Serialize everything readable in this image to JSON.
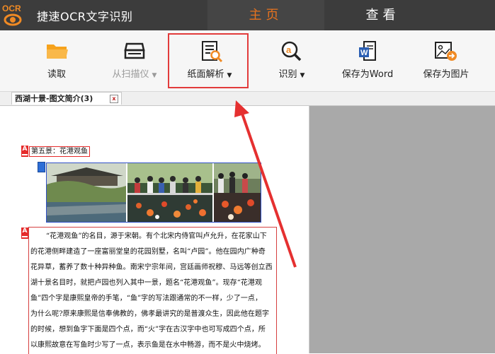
{
  "app": {
    "logo_text": "OCR",
    "title": "捷速OCR文字识别"
  },
  "tabs": [
    {
      "label": "主页",
      "active": true
    },
    {
      "label": "查看",
      "active": false
    }
  ],
  "toolbar": {
    "read": "读取",
    "scanner": "从扫描仪",
    "parse": "纸面解析",
    "recognize": "识别",
    "save_word": "保存为Word",
    "save_image": "保存为图片"
  },
  "colors": {
    "accent": "#e8731e",
    "highlight": "#e23b3b",
    "titlebar": "#3c3c3c"
  },
  "document": {
    "tab_title": "西湖十景-图文简介(3)",
    "tab_close": "x",
    "heading_marker": "A",
    "heading": "第五景：花港观鱼",
    "text_marker": "A",
    "lines": [
      "“花港观鱼”的名目，源于宋朝。有个北宋内侍官叫卢允升，在花家山下",
      "的花港侧畔建造了一座富丽堂皇的花园别墅，名叫“卢园”。他在园内广种奇",
      "花异草，蓄养了数十种异种鱼。南宋宁宗年间，宫廷画师祝穆、马远等创立西",
      "湖十景名目时，就把卢园也列入其中一景，题名“花港观鱼”。现存“花港观",
      "鱼”四个字是康熙皇帝的手笔，“鱼”字的写法跟通常的不一样，少了一点，",
      "为什么呢?原来康熙是信奉佛教的，佛孝最讲究的是普渡众生，因此他在题字",
      "的时候，想到鱼字下面是四个点，而“火”字在古汉字中也可写成四个点，所",
      "以康熙故意在写鱼时少写了一点，表示鱼是在水中畅游，而不是火中烧烤。"
    ]
  }
}
